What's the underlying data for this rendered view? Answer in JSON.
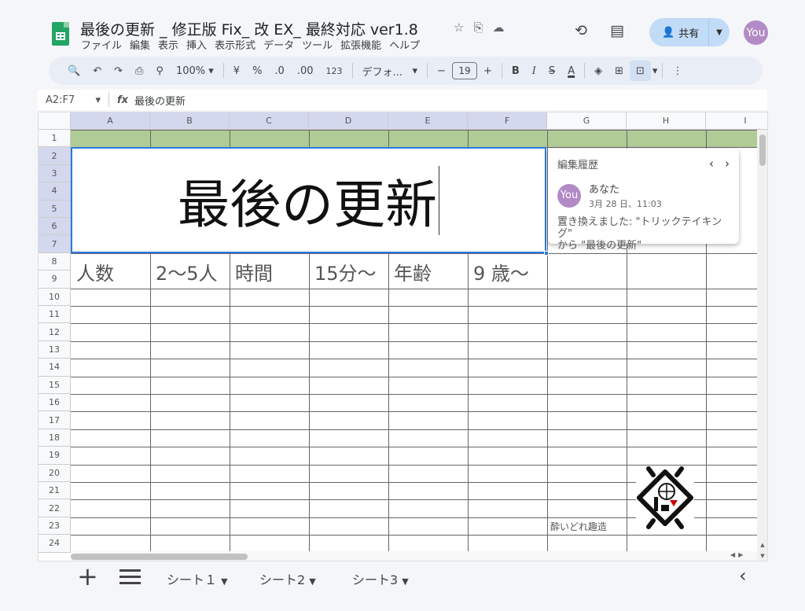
{
  "header": {
    "doc_title": "最後の更新 _ 修正版 Fix_ 改 EX_ 最終対応 ver1.8",
    "menu": [
      "ファイル",
      "編集",
      "表示",
      "挿入",
      "表示形式",
      "データ",
      "ツール",
      "拡張機能",
      "ヘルプ"
    ],
    "share_label": "共有",
    "avatar_label": "You"
  },
  "toolbar": {
    "zoom": "100%",
    "currency": "¥",
    "percent": "%",
    "dec_decrease": ".0",
    "dec_increase": ".00",
    "number_format": "123",
    "font": "デフォ...",
    "font_size": "19",
    "bold": "B",
    "italic": "I",
    "strikethrough": "S",
    "text_color": "A"
  },
  "formula_bar": {
    "name_box": "A2:F7",
    "fx": "fx",
    "content": "最後の更新"
  },
  "columns": [
    "A",
    "B",
    "C",
    "D",
    "E",
    "F",
    "G",
    "H",
    "I"
  ],
  "rows": [
    "1",
    "2",
    "3",
    "4",
    "5",
    "6",
    "7",
    "8",
    "9",
    "10",
    "11",
    "12",
    "13",
    "14",
    "15",
    "16",
    "17",
    "18",
    "19",
    "20",
    "21",
    "22",
    "23",
    "24"
  ],
  "cells": {
    "merged_title": "最後の更新",
    "info": [
      "人数",
      "2～5人",
      "時間",
      "15分～",
      "年齢",
      "9 歳～"
    ],
    "brand_text": "酔いどれ趣造"
  },
  "comment": {
    "title": "編集履歴",
    "avatar": "You",
    "user": "あなた",
    "time": "3月 28 日、11:03",
    "body_line1": "置き換えました: \"トリックテイキング\"",
    "body_line2": "から \"最後の更新\""
  },
  "sheets": [
    {
      "label": "シート１"
    },
    {
      "label": "シート2"
    },
    {
      "label": "シート3"
    }
  ],
  "colors": {
    "green_header": "#b0cb96",
    "selection": "#2b78e4",
    "avatar": "#b28ac5",
    "share": "#c2dbf7"
  }
}
